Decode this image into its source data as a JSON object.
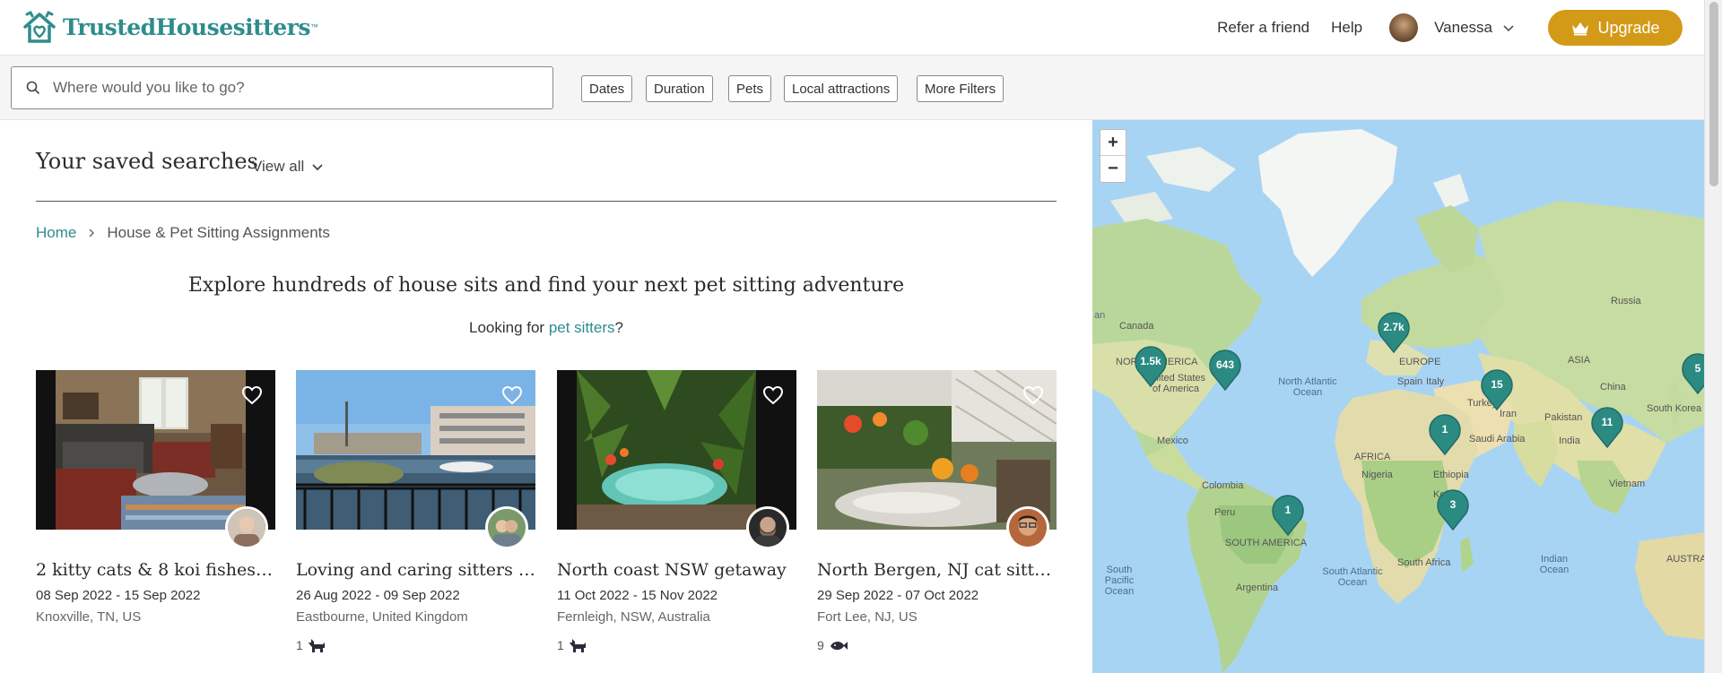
{
  "header": {
    "logo_text": "TrustedHousesitters",
    "logo_tm": "™",
    "nav": {
      "refer": "Refer a friend",
      "help": "Help",
      "user_name": "Vanessa",
      "upgrade": "Upgrade"
    }
  },
  "filters": {
    "search_placeholder": "Where would you like to go?",
    "chips": [
      "Dates",
      "Duration",
      "Pets",
      "Local attractions",
      "More Filters"
    ]
  },
  "saved": {
    "title": "Your saved searches",
    "view_all": "View all"
  },
  "breadcrumb": {
    "home": "Home",
    "current": "House & Pet Sitting Assignments"
  },
  "headline": "Explore hundreds of house sits and find your next pet sitting adventure",
  "looking": {
    "prefix": "Looking for ",
    "link": "pet sitters",
    "suffix": "?"
  },
  "listings": [
    {
      "title": "2 kitty cats & 8 koi fishes to...",
      "dates": "08 Sep 2022 - 15 Sep 2022",
      "location": "Knoxville, TN, US",
      "pets": ""
    },
    {
      "title": "Loving and caring sitters r...",
      "dates": "26 Aug 2022 - 09 Sep 2022",
      "location": "Eastbourne, United Kingdom",
      "pets": "1"
    },
    {
      "title": "North coast NSW getaway",
      "dates": "11 Oct 2022 - 15 Nov 2022",
      "location": "Fernleigh, NSW, Australia",
      "pets": "1"
    },
    {
      "title": "North Bergen, NJ cat sitter ...",
      "dates": "29 Sep 2022 - 07 Oct 2022",
      "location": "Fort Lee, NJ, US",
      "pets": "9"
    }
  ],
  "map": {
    "clusters": [
      "1.5k",
      "643",
      "2.7k",
      "15",
      "1",
      "11",
      "5",
      "3",
      "1"
    ],
    "labels": {
      "canada": "Canada",
      "north_america": "NORTH AMERICA",
      "usa": "United States of America",
      "mexico": "Mexico",
      "colombia": "Colombia",
      "peru": "Peru",
      "south_america": "SOUTH AMERICA",
      "argentina": "Argentina",
      "europe": "EUROPE",
      "russia": "Russia",
      "asia": "ASIA",
      "china": "China",
      "south_korea": "South Korea",
      "india": "India",
      "pakistan": "Pakistan",
      "iran": "Iran",
      "turkey": "Turkey",
      "saudi": "Saudi Arabia",
      "spain": "Spain",
      "italy": "Italy",
      "africa": "AFRICA",
      "nigeria": "Nigeria",
      "ethiopia": "Ethiopia",
      "kenya": "Kenya",
      "south_africa": "South Africa",
      "vietnam": "Vietnam",
      "australia": "AUSTRAL",
      "n_atlantic": "North Atlantic Ocean",
      "s_atlantic": "South Atlantic Ocean",
      "s_pacific": "South Pacific Ocean",
      "indian": "Indian Ocean",
      "pacific_edge": "an"
    }
  }
}
